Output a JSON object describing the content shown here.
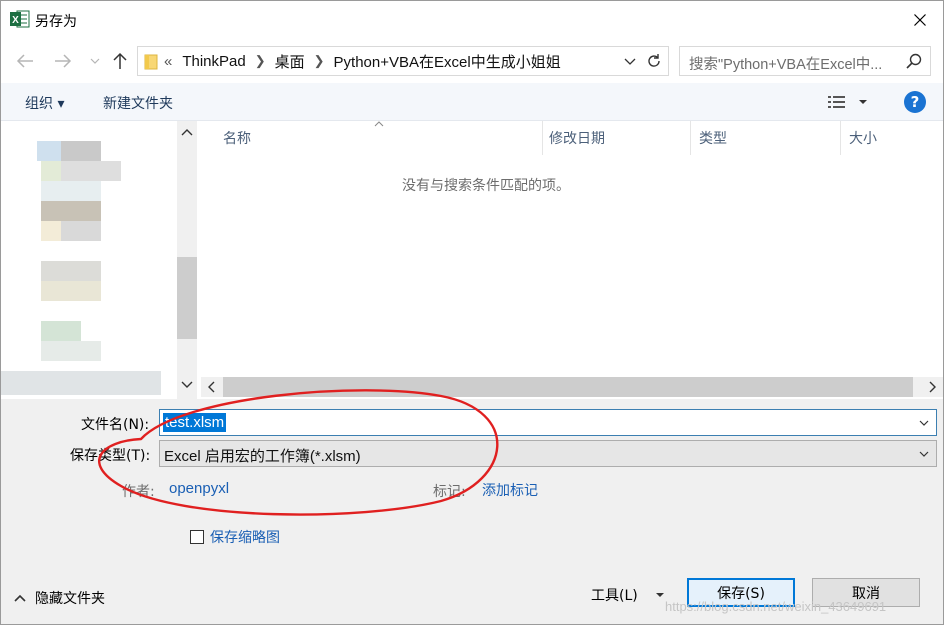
{
  "window": {
    "title": "另存为",
    "close_icon": "close-icon"
  },
  "nav": {
    "crumbs": [
      "ThinkPad",
      "桌面",
      "Python+VBA在Excel中生成小姐姐"
    ],
    "crumb_prefix": "«",
    "search_placeholder": "搜索\"Python+VBA在Excel中..."
  },
  "toolbar": {
    "organize": "组织 ▾",
    "new_folder": "新建文件夹",
    "help": "?"
  },
  "filelist": {
    "columns": [
      "名称",
      "修改日期",
      "类型",
      "大小"
    ],
    "empty_message": "没有与搜索条件匹配的项。"
  },
  "form": {
    "filename_label": "文件名(N):",
    "filename_value": "test.xlsm",
    "filetype_label": "保存类型(T):",
    "filetype_value": "Excel 启用宏的工作簿(*.xlsm)",
    "author_label": "作者:",
    "author_value": "openpyxl",
    "tags_label": "标记:",
    "tags_value": "添加标记",
    "thumbnail_label": "保存缩略图",
    "thumbnail_checked": false
  },
  "footer": {
    "hide_folders": "隐藏文件夹",
    "tools": "工具(L)",
    "save": "保存(S)",
    "cancel": "取消"
  },
  "watermark": "https://blog.csdn.net/weixin_43649691",
  "colors": {
    "accent": "#0078d7",
    "excel_green": "#1d6f42",
    "annotation_red": "#e02020"
  }
}
